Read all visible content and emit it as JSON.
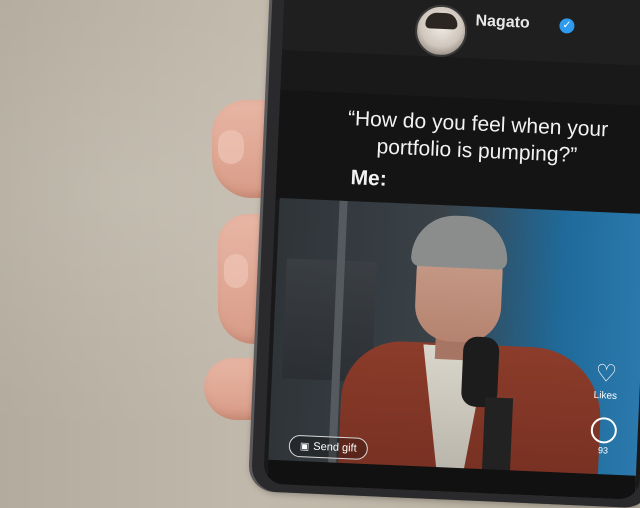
{
  "post": {
    "username": "Nagato",
    "verified_icon": "verified-badge-icon",
    "caption_quote": "“How do you feel when your portfolio is pumping?”",
    "caption_me": "Me:"
  },
  "video": {
    "likes_label": "Likes",
    "comment_count": "93",
    "send_gift_label": "Send gift"
  },
  "colors": {
    "verified": "#2d9bf0",
    "jacket": "#8c3c2a",
    "backdrop_blue": "#2b79ad"
  }
}
